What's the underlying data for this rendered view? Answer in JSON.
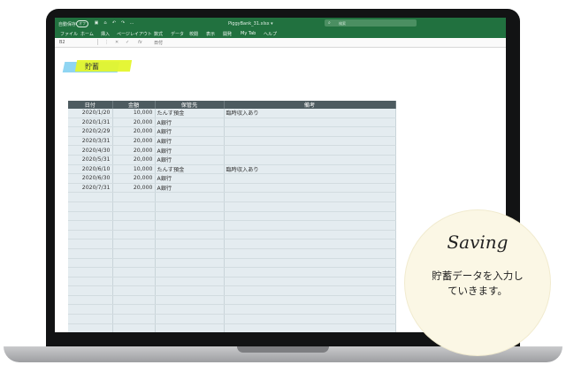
{
  "app": {
    "title": "PiggyBank_31.xlsx ▾",
    "autosave_label": "自動保存",
    "autosave_state": "オフ",
    "search_placeholder": "検索",
    "ribbon_tabs": [
      "ファイル",
      "ホーム",
      "挿入",
      "ページレイアウト",
      "数式",
      "データ",
      "校閲",
      "表示",
      "開発",
      "My Tab",
      "ヘルプ"
    ],
    "name_box": "B2",
    "formula_value": "日付"
  },
  "sheet": {
    "title": "貯蓄",
    "columns": [
      "日付",
      "金額",
      "保管先",
      "備考"
    ],
    "rows": [
      [
        "2020/1/20",
        "10,000",
        "たんす預金",
        "臨時収入あり"
      ],
      [
        "2020/1/31",
        "20,000",
        "A銀行",
        ""
      ],
      [
        "2020/2/29",
        "20,000",
        "A銀行",
        ""
      ],
      [
        "2020/3/31",
        "20,000",
        "A銀行",
        ""
      ],
      [
        "2020/4/30",
        "20,000",
        "A銀行",
        ""
      ],
      [
        "2020/5/31",
        "20,000",
        "A銀行",
        ""
      ],
      [
        "2020/6/10",
        "10,000",
        "たんす預金",
        "臨時収入あり"
      ],
      [
        "2020/6/30",
        "20,000",
        "A銀行",
        ""
      ],
      [
        "2020/7/31",
        "20,000",
        "A銀行",
        ""
      ]
    ],
    "empty_rows": 19
  },
  "badge": {
    "script_text": "Saving",
    "line1": "貯蓄データを入力し",
    "line2": "ていきます。"
  },
  "colors": {
    "excel_green": "#21713f",
    "header_fill": "#4d5b60",
    "cell_fill": "#e4ecf0",
    "highlight_yellow": "#e4f52c",
    "highlight_blue": "#8fd5f2",
    "badge_fill": "#fbf7e5"
  }
}
